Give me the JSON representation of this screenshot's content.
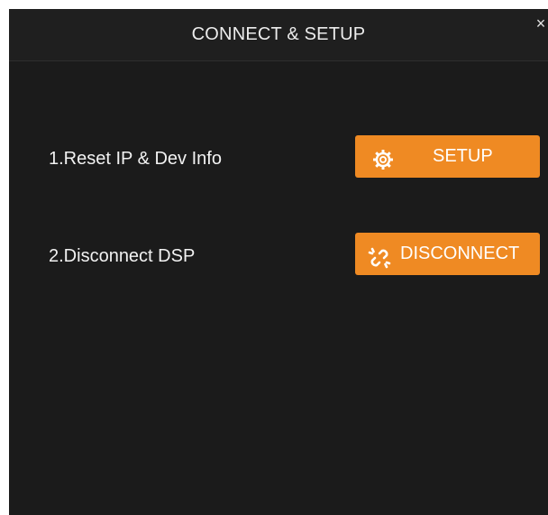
{
  "dialog": {
    "title": "CONNECT & SETUP",
    "close_label": "×"
  },
  "rows": [
    {
      "label": "1.Reset IP & Dev Info",
      "button_label": "SETUP",
      "icon": "gear-icon"
    },
    {
      "label": "2.Disconnect DSP",
      "button_label": "DISCONNECT",
      "icon": "broken-link-icon"
    }
  ],
  "colors": {
    "background": "#1b1b1b",
    "accent": "#ef8a23",
    "text": "#f2f2f2"
  }
}
